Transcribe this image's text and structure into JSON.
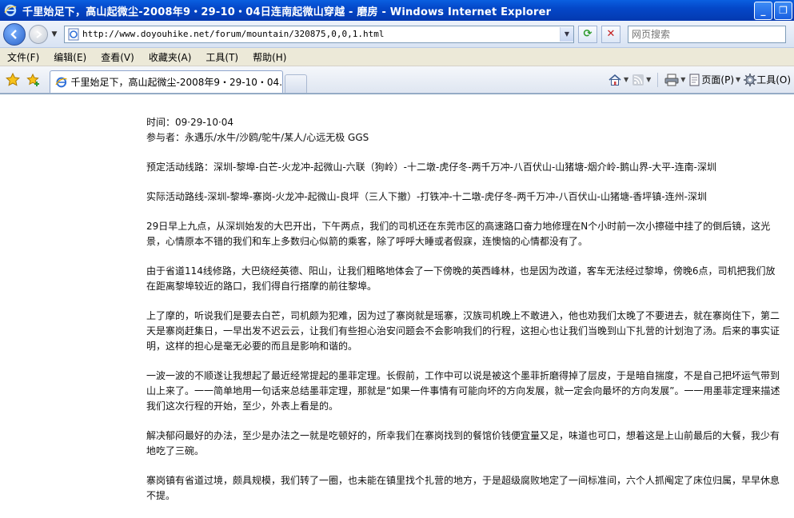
{
  "window": {
    "title": "千里始足下，高山起微尘-2008年9・29-10・04日连南起微山穿越 - 磨房 - Windows Internet Explorer"
  },
  "address_bar": {
    "url": "http://www.doyouhike.net/forum/mountain/320875,0,0,1.html",
    "search_placeholder": "网页搜索"
  },
  "menu": {
    "items": [
      "文件(F)",
      "编辑(E)",
      "查看(V)",
      "收藏夹(A)",
      "工具(T)",
      "帮助(H)"
    ]
  },
  "tabs": {
    "active_label": "千里始足下，高山起微尘-2008年9・29-10・04..."
  },
  "command_bar": {
    "page_label": "页面(P)",
    "tools_label": "工具(O)"
  },
  "article": {
    "time": "时间：09·29-10·04",
    "participants": "参与者：永遇乐/水牛/沙鸥/鸵牛/某人/心远无极  GGS",
    "planned_route": "预定活动线路：深圳-黎埠-白芒-火龙冲-起微山-六联（狗岭）-十二墩-虎仔冬-两千万冲-八百伏山-山猪塘-烟介岭-鹅山界-大平-连南-深圳",
    "actual_route": "实际活动路线-深圳-黎埠-寨岗-火龙冲-起微山-良坪（三人下撤）-打铁冲-十二墩-虎仔冬-两千万冲-八百伏山-山猪塘-香坪镇-连州-深圳",
    "p1": "29日早上九点，从深圳始发的大巴开出，下午两点，我们的司机还在东莞市区的高速路口奋力地修理在N个小时前一次小擦碰中挂了的倒后镜，这光景，心情原本不错的我们和车上多数归心似箭的乘客，除了呼呼大睡或者假寐，连懊恼的心情都没有了。",
    "p2": "由于省道114线修路，大巴绕经英德、阳山，让我们粗略地体会了一下傍晚的英西峰林，也是因为改道，客车无法经过黎埠，傍晚6点，司机把我们放在距离黎埠较近的路口，我们得自行搭摩的前往黎埠。",
    "p3": "上了摩的，听说我们是要去白芒，司机颇为犯难，因为过了寨岗就是瑶寨，汉族司机晚上不敢进入，他也劝我们太晚了不要进去，就在寨岗住下，第二天是寨岗赶集日，一早出发不迟云云，让我们有些担心治安问题会不会影响我们的行程，这担心也让我们当晚到山下扎营的计划泡了汤。后来的事实证明，这样的担心是毫无必要的而且是影响和谐的。",
    "p4": "一波一波的不顺遂让我想起了最近经常提起的墨菲定理。长假前，工作中可以说是被这个墨菲折磨得掉了层皮，于是暗自揣度，不是自己把坏运气带到山上来了。一一简单地用一句话来总结墨菲定理，那就是“如果一件事情有可能向坏的方向发展，就一定会向最坏的方向发展”。一一用墨菲定理来描述我们这次行程的开始，至少，外表上看是的。",
    "p5": "解决郁闷最好的办法，至少是办法之一就是吃顿好的，所幸我们在寨岗找到的餐馆价钱便宜量又足，味道也可口，想着这是上山前最后的大餐，我少有地吃了三碗。",
    "p6": "寨岗镇有省道过境，颇具规模，我们转了一圈，也未能在镇里找个扎营的地方，于是超级腐败地定了一间标准间，六个人抓阄定了床位归属，早早休息不提。"
  },
  "colors": {
    "titlebar": "#0447c8",
    "menubar": "#ece9d8",
    "link_blue": "#1a5fe0"
  },
  "icons": [
    "ie-icon",
    "minimize-icon",
    "maximize-icon",
    "close-icon",
    "back-icon",
    "forward-icon",
    "page-icon",
    "refresh-icon",
    "stop-icon",
    "favorites-star-icon",
    "add-favorites-icon",
    "home-icon",
    "feeds-icon",
    "print-icon",
    "page-menu-icon",
    "tools-gear-icon"
  ]
}
